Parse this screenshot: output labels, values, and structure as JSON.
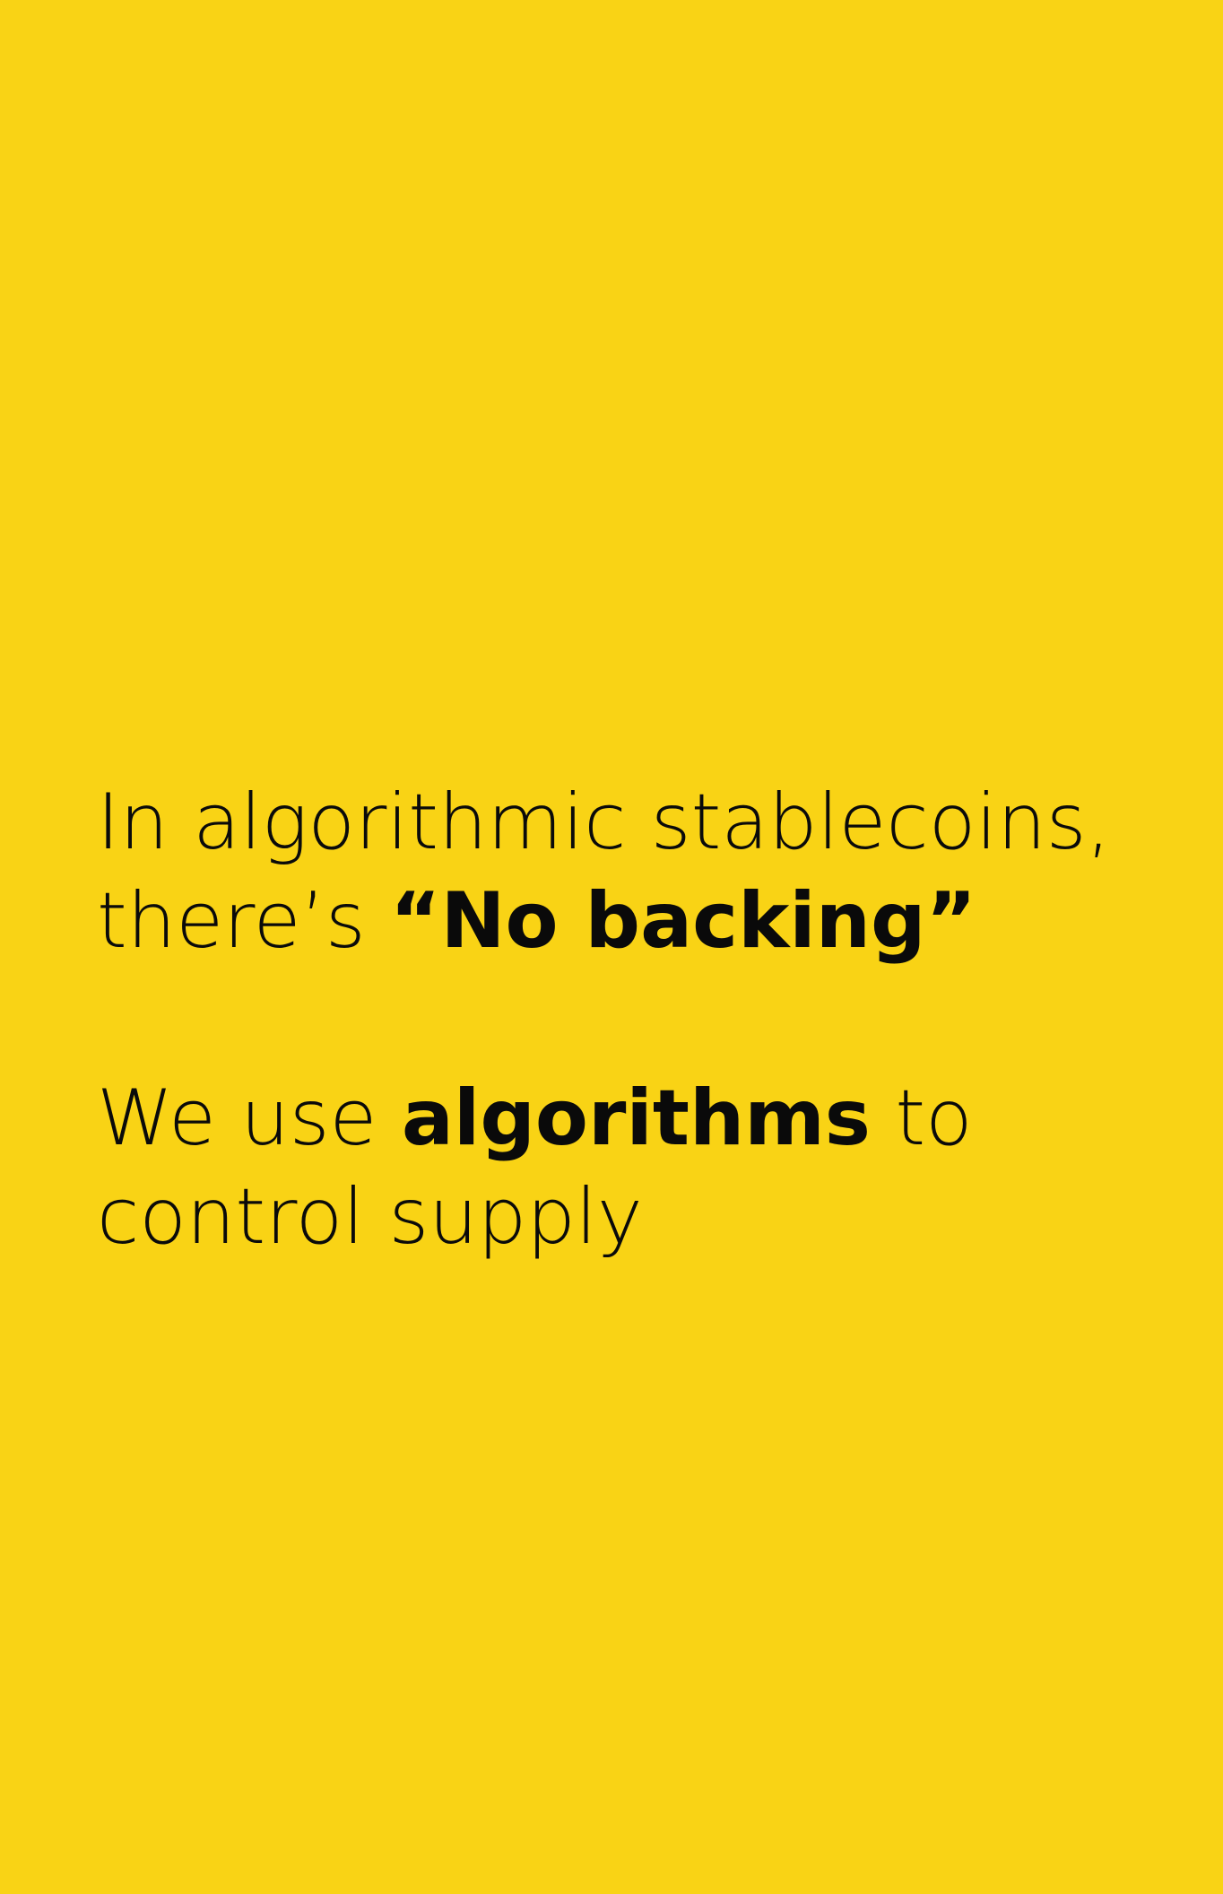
{
  "background_color": "#F9D315",
  "text_color": "#0a0a0a",
  "paragraph_1": {
    "line_1": "In algorithmic stablecoins,",
    "line_2_prefix": "there’s ",
    "line_2_emphasis": "“No backing”"
  },
  "paragraph_2": {
    "line_1_prefix": "We use ",
    "line_1_emphasis": "algorithms",
    "line_1_suffix": " to",
    "line_2": "control supply"
  }
}
